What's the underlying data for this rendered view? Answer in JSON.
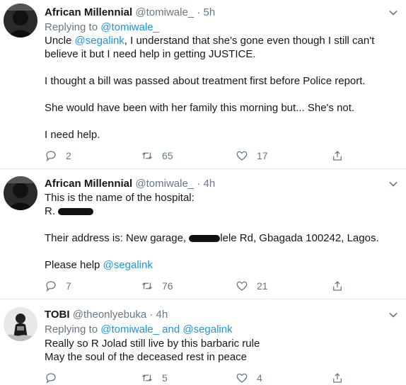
{
  "tweets": [
    {
      "name": "African Millennial",
      "handle": "@tomiwale_",
      "dot": "·",
      "time": "5h",
      "replying_prefix": "Replying to",
      "replying_to": "@tomiwale_",
      "line1_a": "Uncle ",
      "line1_link": "@segalink",
      "line1_b": ", I understand that she's gone even though I still can't",
      "line2": "believe it but I need help in getting JUSTICE.",
      "line3": "I thought a bill was passed about treatment first before Police report.",
      "line4": "She would have been with her family this morning but... She's not.",
      "line5": "I need help.",
      "replies": "2",
      "retweets": "65",
      "likes": "17"
    },
    {
      "name": "African Millennial",
      "handle": "@tomiwale_",
      "dot": "·",
      "time": "4h",
      "line1": "This is the name of the hospital:",
      "line2": "R.",
      "line3_a": "Their address is: New garage, ",
      "line3_b": "lele Rd, Gbagada 100242, Lagos.",
      "line4_a": "Please help ",
      "line4_link": "@segalink",
      "replies": "7",
      "retweets": "76",
      "likes": "21"
    },
    {
      "name": "TOBI",
      "handle": "@theonlyebuka",
      "dot": "·",
      "time": "4h",
      "replying_prefix": "Replying to",
      "replying_to": "@tomiwale_ and @segalink",
      "line1": "Really so R Jolad still live by this barbaric rule",
      "line2": "May the soul of the deceased rest in peace",
      "replies": "",
      "retweets": "5",
      "likes": "4"
    }
  ],
  "colors": {
    "link": "#1b95e0",
    "muted": "#657786",
    "text": "#14171a",
    "divider": "#e6ecf0"
  },
  "icons": [
    "reply-icon",
    "retweet-icon",
    "like-icon",
    "share-icon",
    "chevron-down-icon"
  ]
}
